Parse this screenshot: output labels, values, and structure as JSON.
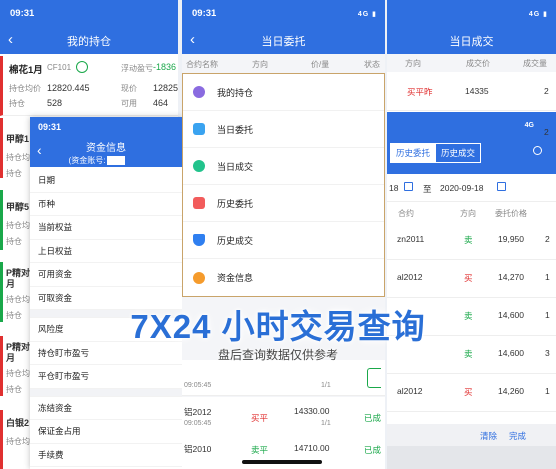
{
  "status_time": "09:31",
  "network": "4G",
  "panel1": {
    "title": "我的持仓",
    "stock_name": "棉花1月",
    "stock_code": "CF101",
    "float_label": "浮动盈亏",
    "float_value": "-1836",
    "avg_label": "持仓均价",
    "avg_value": "12820.445",
    "price_label": "现价",
    "price_value": "12825",
    "hold_label": "持仓",
    "hold_value": "528",
    "avail_label": "可用",
    "avail_value": "464",
    "side_rows": [
      "甲醇1",
      "持仓均",
      "持仓",
      "甲醇5",
      "持仓均",
      "持仓",
      "P精对",
      "月",
      "持仓均",
      "持仓",
      "P精对",
      "月",
      "持仓均",
      "持仓",
      "白银2",
      "持仓均"
    ]
  },
  "overlay": {
    "title": "资金信息",
    "subtitle": "(资金账号:",
    "items": [
      "日期",
      "币种",
      "当前权益",
      "上日权益",
      "可用资金",
      "可取资金",
      "风险度",
      "持仓盯市盈亏",
      "平仓盯市盈亏",
      "冻结资金",
      "保证金占用",
      "手续费"
    ]
  },
  "panel2": {
    "title": "当日委托",
    "columns": [
      "合约名称",
      "方向",
      "价/量",
      "状态"
    ],
    "menu": [
      "我的持仓",
      "当日委托",
      "当日成交",
      "历史委托",
      "历史成交",
      "资金信息"
    ],
    "rows": [
      {
        "name": "",
        "time": "09:05:45",
        "dir": "",
        "price": "",
        "qty": "1/1",
        "status": ""
      },
      {
        "name": "铝2012",
        "time": "09:05:45",
        "dir": "买平",
        "price": "14330.00",
        "qty": "1/1",
        "status": "已成"
      },
      {
        "name": "铝2010",
        "time": "",
        "dir": "卖平",
        "price": "14710.00",
        "qty": "",
        "status": "已成"
      }
    ]
  },
  "panel3": {
    "title": "当日成交",
    "columns": [
      "方向",
      "成交价",
      "成交量"
    ],
    "first_row": {
      "dir": "买平昨",
      "price": "14335",
      "qty": "2"
    },
    "right_nums": [
      "2",
      "2",
      "2"
    ]
  },
  "history": {
    "tab_active": "历史委托",
    "tab_other": "历史成交",
    "date_from": "18",
    "to_label": "至",
    "date_to": "2020-09-18",
    "columns": [
      "合约",
      "方向",
      "委托价格"
    ],
    "rows": [
      {
        "contract": "zn2011",
        "dir": "卖",
        "price": "19,950",
        "qty": "2"
      },
      {
        "contract": "al2012",
        "dir": "买",
        "price": "14,270",
        "qty": "1"
      },
      {
        "contract": "",
        "dir": "卖",
        "price": "14,600",
        "qty": "1"
      },
      {
        "contract": "",
        "dir": "卖",
        "price": "14,600",
        "qty": "3"
      },
      {
        "contract": "al2012",
        "dir": "买",
        "price": "14,260",
        "qty": "1"
      }
    ],
    "clear": "清除",
    "done": "完成"
  },
  "banner": {
    "headline": "7X24 小时交易查询",
    "subline": "盘后查询数据仅供参考"
  }
}
